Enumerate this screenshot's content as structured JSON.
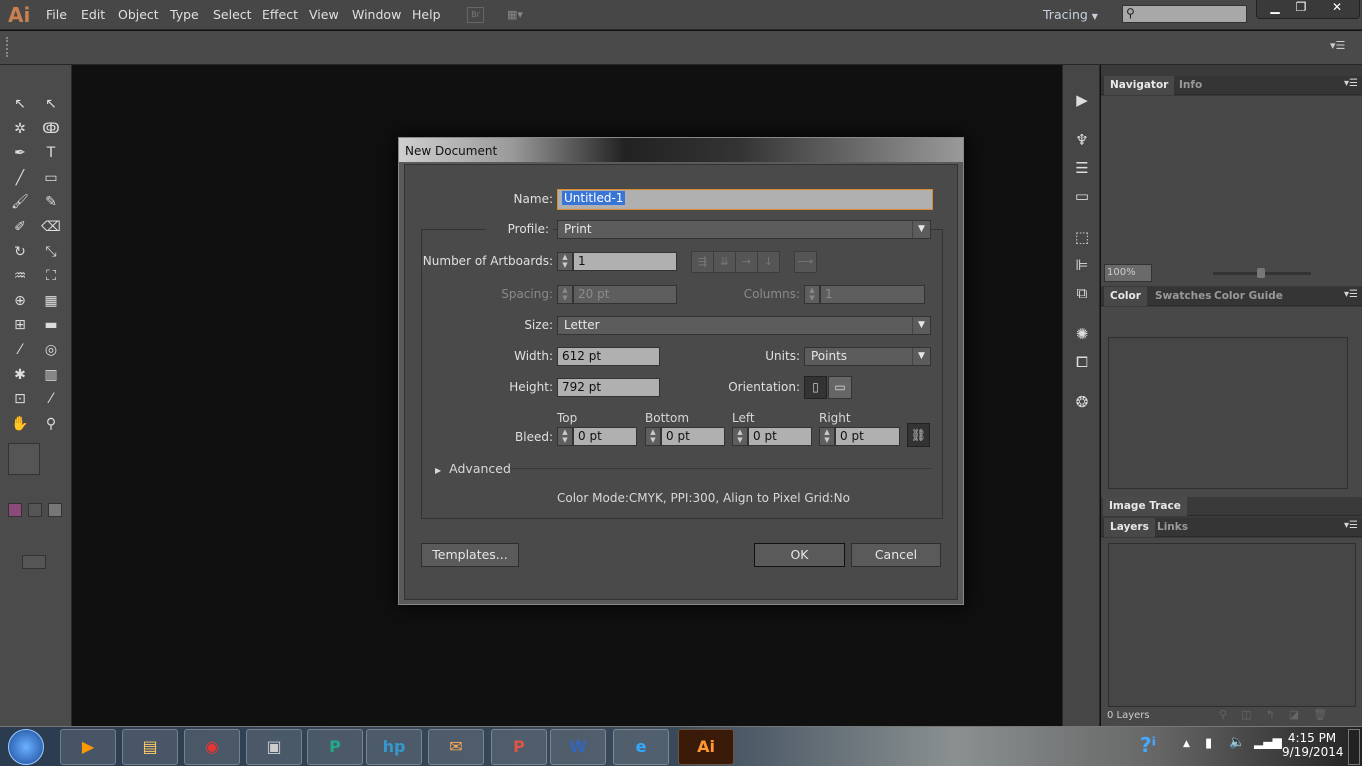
{
  "app": {
    "logo": "Ai",
    "menus": [
      "File",
      "Edit",
      "Object",
      "Type",
      "Select",
      "Effect",
      "View",
      "Window",
      "Help"
    ],
    "bridge": "Br",
    "workspace": "Tracing",
    "search_placeholder": ""
  },
  "dialog": {
    "title": "New Document",
    "name_label": "Name:",
    "name_value": "Untitled-1",
    "profile_label": "Profile:",
    "profile_value": "Print",
    "artboards_label": "Number of Artboards:",
    "artboards_value": "1",
    "spacing_label": "Spacing:",
    "spacing_value": "20 pt",
    "columns_label": "Columns:",
    "columns_value": "1",
    "size_label": "Size:",
    "size_value": "Letter",
    "width_label": "Width:",
    "width_value": "612 pt",
    "units_label": "Units:",
    "units_value": "Points",
    "height_label": "Height:",
    "height_value": "792 pt",
    "orientation_label": "Orientation:",
    "bleed_label": "Bleed:",
    "bleed": [
      {
        "label": "Top",
        "value": "0 pt"
      },
      {
        "label": "Bottom",
        "value": "0 pt"
      },
      {
        "label": "Left",
        "value": "0 pt"
      },
      {
        "label": "Right",
        "value": "0 pt"
      }
    ],
    "advanced_label": "Advanced",
    "summary": "Color Mode:CMYK, PPI:300, Align to Pixel Grid:No",
    "templates_button": "Templates...",
    "ok_button": "OK",
    "cancel_button": "Cancel"
  },
  "panels": {
    "navigator_tabs": [
      "Navigator",
      "Info"
    ],
    "zoom_value": "100%",
    "color_tabs": [
      "Color",
      "Swatches",
      "Color Guide"
    ],
    "image_trace": "Image Trace",
    "layers_tabs": [
      "Layers",
      "Links"
    ],
    "layers_count": "0 Layers"
  },
  "taskbar": {
    "time": "4:15 PM",
    "date": "9/19/2014",
    "apps": [
      "media-player",
      "file-explorer",
      "chrome",
      "app",
      "publisher",
      "hp",
      "app2",
      "powerpoint",
      "word",
      "internet-explorer",
      "illustrator"
    ]
  },
  "colors": {
    "accent": "#c98050",
    "selection": "#3875d7",
    "focus": "#d98b2e"
  }
}
